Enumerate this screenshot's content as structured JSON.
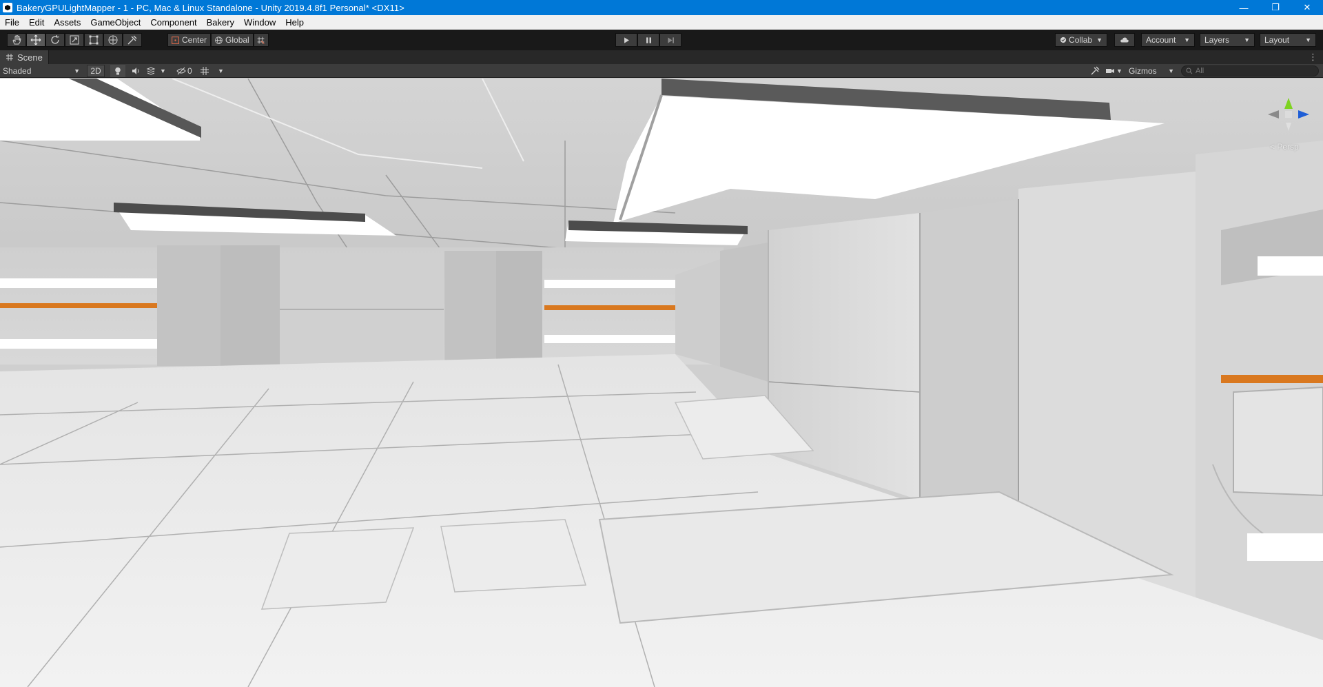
{
  "window": {
    "title": "BakeryGPULightMapper - 1 - PC, Mac & Linux Standalone - Unity 2019.4.8f1 Personal* <DX11>",
    "minimize": "—",
    "maximize": "❐",
    "close": "✕"
  },
  "menu": {
    "items": [
      "File",
      "Edit",
      "Assets",
      "GameObject",
      "Component",
      "Bakery",
      "Window",
      "Help"
    ]
  },
  "toolbar": {
    "tools": [
      "hand-icon",
      "move-icon",
      "rotate-icon",
      "scale-icon",
      "rect-icon",
      "transform-icon",
      "custom-tool-icon"
    ],
    "pivot_mode": "Center",
    "pivot_rotation": "Global",
    "collab_label": "Collab",
    "account_label": "Account",
    "layers_label": "Layers",
    "layout_label": "Layout"
  },
  "tab": {
    "label": "Scene",
    "menu": "⋮"
  },
  "scene_toolbar": {
    "draw_mode": "Shaded",
    "mode_2d": "2D",
    "hidden_count": "0",
    "gizmos_label": "Gizmos",
    "search_placeholder": "All"
  },
  "gizmo": {
    "label": "< Persp"
  },
  "colors": {
    "titlebar": "#0078d7",
    "toolbar": "#191919",
    "panel": "#3c3c3c",
    "accent_stripe": "#d9781f"
  }
}
